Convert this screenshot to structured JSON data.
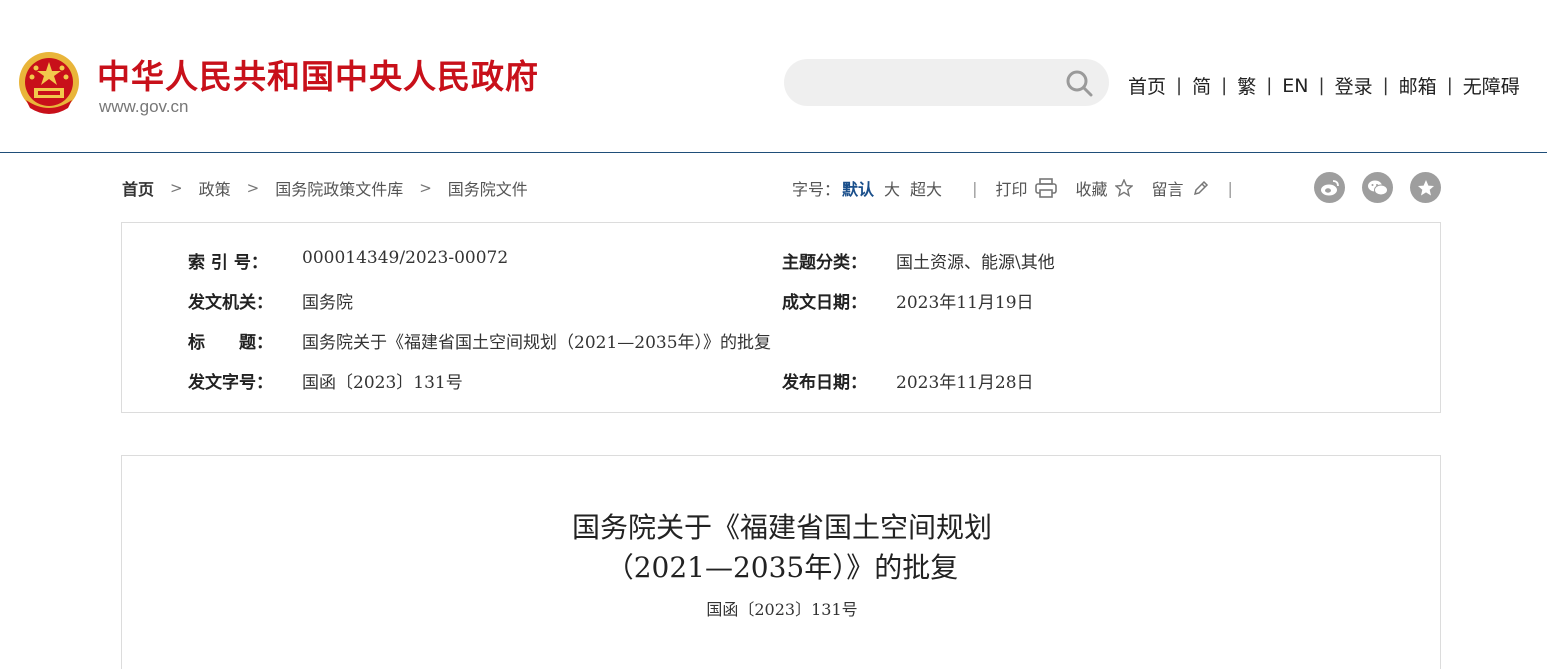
{
  "header": {
    "site_title": "中华人民共和国中央人民政府",
    "site_url": "www.gov.cn",
    "search_placeholder": "",
    "nav": [
      "首页",
      "简",
      "繁",
      "EN",
      "登录",
      "邮箱",
      "无障碍"
    ],
    "nav_separator": "|",
    "brand_color": "#c8101a"
  },
  "breadcrumb": {
    "items": [
      "首页",
      "政策",
      "国务院政策文件库",
      "国务院文件"
    ],
    "separator": ">"
  },
  "tools": {
    "font_size_label": "字号：",
    "font_default": "默认",
    "font_large": "大",
    "font_xlarge": "超大",
    "print": "打印",
    "favorite": "收藏",
    "comment": "留言",
    "share_icons": [
      "weibo-icon",
      "wechat-icon",
      "star-icon"
    ]
  },
  "info": {
    "index_no_label": "索 引 号：",
    "index_no": "000014349/2023-00072",
    "topic_label": "主题分类：",
    "topic": "国土资源、能源\\其他",
    "issuer_label": "发文机关：",
    "issuer": "国务院",
    "written_date_label": "成文日期：",
    "written_date": "2023年11月19日",
    "title_label": "标　　题：",
    "title": "国务院关于《福建省国土空间规划（2021—2035年）》的批复",
    "doc_no_label": "发文字号：",
    "doc_no": "国函〔2023〕131号",
    "publish_date_label": "发布日期：",
    "publish_date": "2023年11月28日"
  },
  "document": {
    "title_line1": "国务院关于《福建省国土空间规划",
    "title_line2": "（2021—2035年）》的批复",
    "doc_number": "国函〔2023〕131号"
  }
}
